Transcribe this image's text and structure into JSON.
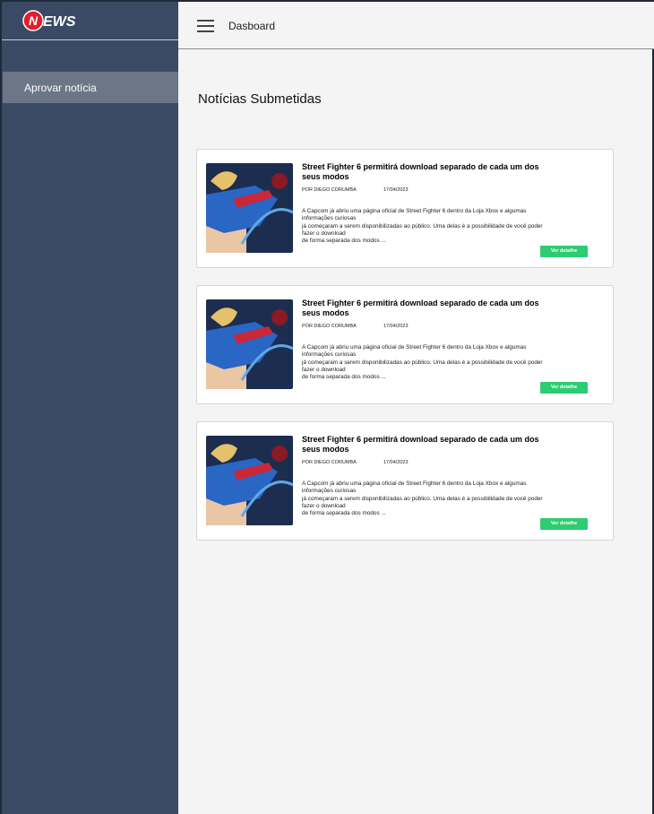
{
  "brand": {
    "logo_text": "NEWS",
    "logo_color": "#e11d2e"
  },
  "header": {
    "title": "Dasboard"
  },
  "sidebar": {
    "items": [
      {
        "label": "Aprovar notícia",
        "active": true
      }
    ]
  },
  "main": {
    "page_title": "Notícias Submetidas",
    "articles": [
      {
        "title": "Street Fighter 6 permitirá download separado de cada um dos seus modos",
        "author": "POR DIEGO CORUMBA",
        "date": "17/04/2023",
        "excerpt_lines": [
          "A Capcom já abriu uma página oficial de Street Fighter 6 dentro da Loja Xbox e algumas",
          "informações curiosas",
          "já começaram a serem disponibilizadas ao público. Uma delas é a possibilidade de você poder",
          "fazer o download",
          "de forma separada dos modos ..."
        ],
        "button_label": "Ver detalhe"
      },
      {
        "title": "Street Fighter 6 permitirá download separado de cada um dos seus modos",
        "author": "POR DIEGO CORUMBA",
        "date": "17/04/2023",
        "excerpt_lines": [
          "A Capcom já abriu uma página oficial de Street Fighter 6 dentro da Loja Xbox e algumas",
          "informações curiosas",
          "já começaram a serem disponibilizadas ao público. Uma delas é a possibilidade de você poder",
          "fazer o download",
          "de forma separada dos modos ..."
        ],
        "button_label": "Ver detalhe"
      },
      {
        "title": "Street Fighter 6 permitirá download separado de cada um dos seus modos",
        "author": "POR DIEGO CORUMBA",
        "date": "17/04/2023",
        "excerpt_lines": [
          "A Capcom já abriu uma página oficial de Street Fighter 6 dentro da Loja Xbox e algumas",
          "informações curiosas",
          "já começaram a serem disponibilizadas ao público. Uma delas é a possibilidade de você poder",
          "fazer o download",
          "de forma separada dos modos ..."
        ],
        "button_label": "Ver detalhe"
      }
    ]
  },
  "colors": {
    "sidebar_bg": "#3b4a64",
    "sidebar_active": "#6b7686",
    "accent_button": "#2ecc71",
    "page_bg": "#f4f4f4"
  }
}
